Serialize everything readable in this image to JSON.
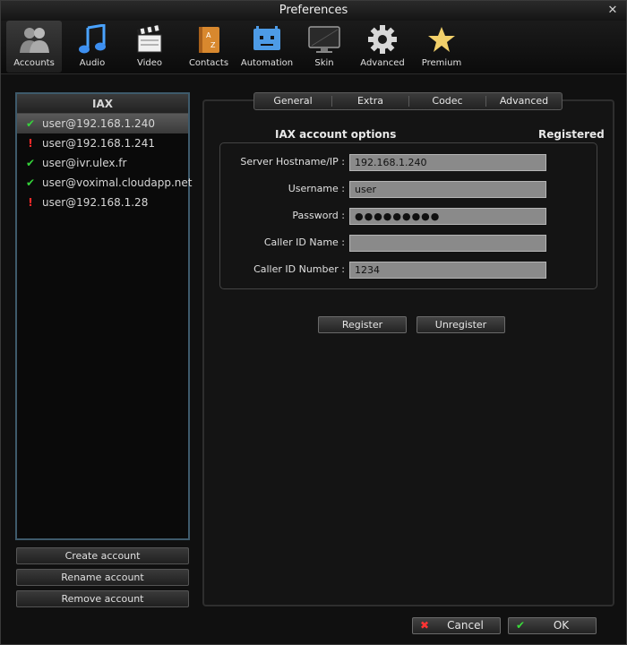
{
  "window": {
    "title": "Preferences"
  },
  "toolbar": {
    "items": [
      {
        "label": "Accounts"
      },
      {
        "label": "Audio"
      },
      {
        "label": "Video"
      },
      {
        "label": "Contacts"
      },
      {
        "label": "Automation"
      },
      {
        "label": "Skin"
      },
      {
        "label": "Advanced"
      },
      {
        "label": "Premium"
      }
    ]
  },
  "accounts": {
    "header": "IAX",
    "rows": [
      {
        "status_icon": "✔",
        "label": "user@192.168.1.240"
      },
      {
        "status_icon": "!",
        "label": "user@192.168.1.241"
      },
      {
        "status_icon": "✔",
        "label": "user@ivr.ulex.fr"
      },
      {
        "status_icon": "✔",
        "label": "user@voximal.cloudapp.net"
      },
      {
        "status_icon": "!",
        "label": "user@192.168.1.28"
      }
    ],
    "buttons": {
      "create": "Create account",
      "rename": "Rename account",
      "remove": "Remove account"
    }
  },
  "tabs": [
    "General",
    "Extra",
    "Codec",
    "Advanced"
  ],
  "options": {
    "title": "IAX account options",
    "status": "Registered",
    "fields": [
      {
        "label": "Server Hostname/IP :",
        "value": "192.168.1.240"
      },
      {
        "label": "Username :",
        "value": "user"
      },
      {
        "label": "Password :",
        "value": "●●●●●●●●●"
      },
      {
        "label": "Caller ID Name :",
        "value": ""
      },
      {
        "label": "Caller ID Number :",
        "value": "1234"
      }
    ],
    "register": "Register",
    "unregister": "Unregister"
  },
  "footer": {
    "cancel_icon": "✖",
    "cancel": "Cancel",
    "ok_icon": "✔",
    "ok": "OK"
  }
}
